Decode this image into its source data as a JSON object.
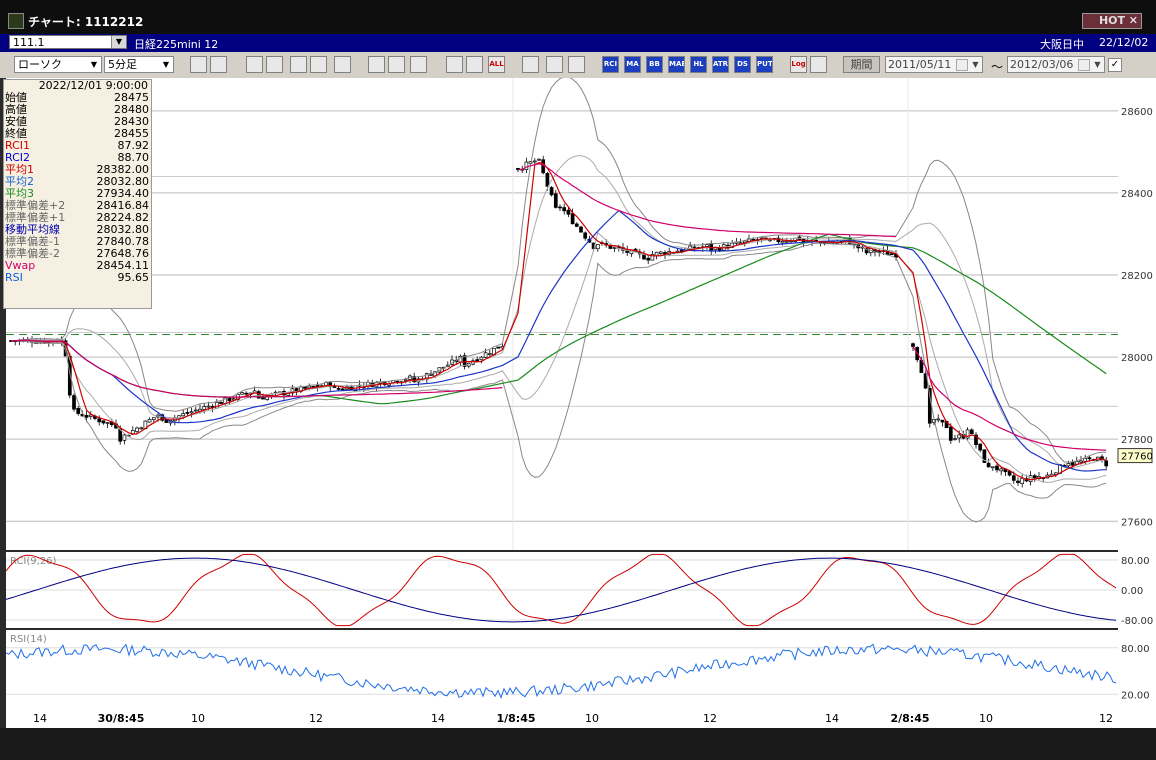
{
  "window": {
    "title": "チャート: 1112212",
    "hot_label": "HOT",
    "close_label": "✕"
  },
  "symbol_bar": {
    "symbol": "111.1",
    "instrument": "日経225mini 12",
    "session": "大阪日中",
    "date": "22/12/02"
  },
  "toolbar": {
    "chart_type": "ローソク",
    "interval": "5分足",
    "buttons": [
      "zoom",
      "cross",
      "down",
      "zoom-in",
      "img",
      "split",
      "calc",
      "line",
      "pointer",
      "undo",
      "candle",
      "candle2",
      "ALL",
      "gear",
      "pen",
      "color",
      "RCI",
      "MA",
      "BB",
      "MAE",
      "HL",
      "ATR",
      "DS",
      "PUT",
      "Log",
      "exit"
    ],
    "period_label": "期間",
    "date_from": "2011/05/11",
    "tilde": "〜",
    "date_to": "2012/03/06"
  },
  "info_panel": {
    "datetime": "2022/12/01 9:00:00",
    "rows": [
      {
        "k": "始値",
        "v": "28475",
        "c": "#000000"
      },
      {
        "k": "高値",
        "v": "28480",
        "c": "#000000"
      },
      {
        "k": "安値",
        "v": "28430",
        "c": "#000000"
      },
      {
        "k": "終値",
        "v": "28455",
        "c": "#000000"
      },
      {
        "k": "RCI1",
        "v": "87.92",
        "c": "#cc0000"
      },
      {
        "k": "RCI2",
        "v": "88.70",
        "c": "#0000cc"
      },
      {
        "k": "平均1",
        "v": "28382.00",
        "c": "#cc0000"
      },
      {
        "k": "平均2",
        "v": "28032.80",
        "c": "#1560d0"
      },
      {
        "k": "平均3",
        "v": "27934.40",
        "c": "#1a8a1a"
      },
      {
        "k": "標準偏差+2",
        "v": "28416.84",
        "c": "#666666"
      },
      {
        "k": "標準偏差+1",
        "v": "28224.82",
        "c": "#666666"
      },
      {
        "k": "移動平均線",
        "v": "28032.80",
        "c": "#0000aa"
      },
      {
        "k": "標準偏差-1",
        "v": "27840.78",
        "c": "#666666"
      },
      {
        "k": "標準偏差-2",
        "v": "27648.76",
        "c": "#666666"
      },
      {
        "k": "Vwap",
        "v": "28454.11",
        "c": "#d0006a"
      },
      {
        "k": "RSI",
        "v": "95.65",
        "c": "#1060e0"
      }
    ]
  },
  "chart_data": [
    {
      "type": "candlestick",
      "ylim": [
        27530,
        28680
      ],
      "yticks": [
        "28600",
        "28400",
        "28200",
        "28000",
        "27800",
        "27600"
      ],
      "current_price": "27760",
      "dashed_level": 28055,
      "session_boundaries": [
        1,
        2
      ],
      "x_labels": [
        "14",
        "30/8:45",
        "10",
        "12",
        "14",
        "1/8:45",
        "10",
        "12",
        "14",
        "2/8:45",
        "10",
        "12"
      ],
      "session_paths": [
        {
          "day": "30",
          "segments": [
            [
              0,
              28040,
              28060
            ],
            [
              0.11,
              28020,
              28040
            ],
            [
              0.12,
              27870,
              27910
            ],
            [
              0.22,
              27800,
              27830
            ],
            [
              0.3,
              27840,
              27860
            ],
            [
              0.5,
              27900,
              27920
            ],
            [
              0.65,
              27920,
              27935
            ],
            [
              0.82,
              27940,
              27950
            ],
            [
              0.92,
              27980,
              28000
            ],
            [
              1,
              28000,
              28030
            ]
          ]
        },
        {
          "day": "1",
          "segments": [
            [
              0,
              28460,
              28470
            ],
            [
              0.05,
              28490,
              28480
            ],
            [
              0.1,
              28380,
              28360
            ],
            [
              0.2,
              28280,
              28270
            ],
            [
              0.35,
              28250,
              28240
            ],
            [
              0.5,
              28260,
              28270
            ],
            [
              0.65,
              28280,
              28290
            ],
            [
              0.75,
              28280,
              28290
            ],
            [
              0.86,
              28290,
              28280
            ],
            [
              0.93,
              28260,
              28250
            ],
            [
              1,
              28240,
              28250
            ]
          ]
        },
        {
          "day": "2",
          "segments": [
            [
              0,
              28030,
              28020
            ],
            [
              0.05,
              27980,
              27960
            ],
            [
              0.1,
              27850,
              27780
            ],
            [
              0.18,
              27800,
              27830
            ],
            [
              0.28,
              27830,
              27810
            ],
            [
              0.4,
              27740,
              27720
            ],
            [
              0.55,
              27700,
              27690
            ],
            [
              0.66,
              27700,
              27710
            ],
            [
              0.82,
              27740,
              27750
            ],
            [
              0.92,
              27760,
              27750
            ],
            [
              1,
              27750,
              27740
            ]
          ]
        }
      ]
    },
    {
      "type": "line",
      "title": "RCI(9,26)",
      "yticks": [
        "80.00",
        "0.00",
        "-80.00"
      ],
      "series": [
        {
          "name": "RCI1",
          "color": "#cc0000"
        },
        {
          "name": "RCI2",
          "color": "#000080"
        }
      ]
    },
    {
      "type": "line",
      "title": "RSI(14)",
      "yticks": [
        "80.00",
        "20.00"
      ],
      "series": [
        {
          "name": "RSI",
          "color": "#1f6ee8"
        }
      ]
    }
  ]
}
